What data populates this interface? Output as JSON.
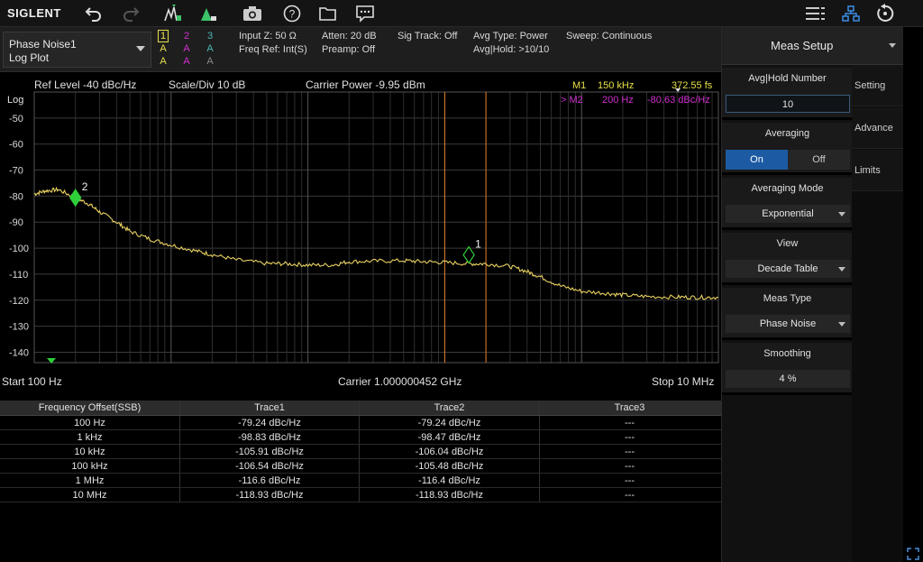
{
  "toolbar": {
    "logo": "SIGLENT"
  },
  "mode": {
    "line1": "Phase Noise1",
    "line2": "Log Plot"
  },
  "traces": [
    {
      "num": "1",
      "row2": "A",
      "row3": "A",
      "color": "#e8e04a"
    },
    {
      "num": "2",
      "row2": "A",
      "row3": "A",
      "color": "#d030d0"
    },
    {
      "num": "3",
      "row2": "A",
      "row3": "A",
      "color": "#4ab8b8"
    }
  ],
  "info": {
    "input_z": "Input Z: 50 Ω",
    "freq_ref": "Freq Ref: Int(S)",
    "atten": "Atten: 20 dB",
    "preamp": "Preamp: Off",
    "sig_track": "Sig Track: Off",
    "avg_type": "Avg Type: Power",
    "avg_hold": "Avg|Hold: >10/10",
    "sweep": "Sweep: Continuous"
  },
  "plot_header": {
    "ref_level": "Ref Level  -40 dBc/Hz",
    "scale": "Scale/Div  10 dB",
    "carrier_power": "Carrier Power  -9.95 dBm",
    "m1_label": "M1",
    "m1_freq": "150 kHz",
    "m1_val": "372.55 fs",
    "m2_label": "> M2",
    "m2_freq": "200 Hz",
    "m2_val": "-80.63 dBc/Hz"
  },
  "y_unit": "Log",
  "y_ticks": [
    "-50",
    "-60",
    "-70",
    "-80",
    "-90",
    "-100",
    "-110",
    "-120",
    "-130",
    "-140"
  ],
  "plot_footer": {
    "start": "Start  100 Hz",
    "carrier": "Carrier  1.000000452 GHz",
    "stop": "Stop  10 MHz"
  },
  "chart_data": {
    "type": "line",
    "x_scale": "log",
    "xlim": [
      100,
      10000000
    ],
    "ylim": [
      -144,
      -40
    ],
    "series": [
      {
        "color": "#e8d060",
        "x": [
          100,
          120,
          150,
          200,
          250,
          300,
          400,
          500,
          700,
          1000,
          1500,
          2000,
          3000,
          5000,
          7000,
          10000,
          15000,
          20000,
          30000,
          50000,
          70000,
          100000,
          150000,
          200000,
          300000,
          400000,
          500000,
          700000,
          1000000,
          1500000,
          2000000,
          3000000,
          5000000,
          7000000,
          10000000
        ],
        "y": [
          -79.2,
          -78,
          -77.5,
          -80.6,
          -83,
          -86,
          -90,
          -93.5,
          -96.5,
          -98.8,
          -101,
          -102.5,
          -104.5,
          -105.9,
          -106,
          -106.5,
          -106.5,
          -105.2,
          -105,
          -104.8,
          -105.2,
          -105.5,
          -106,
          -106,
          -107,
          -109,
          -111,
          -114.5,
          -116.6,
          -117.3,
          -118,
          -118.6,
          -118.8,
          -118.9,
          -118.9
        ]
      }
    ],
    "markers": [
      {
        "label": "1",
        "x": 150000,
        "y": -102.6
      },
      {
        "label": "2",
        "x": 200,
        "y": -80.63
      }
    ],
    "vlines": [
      100000,
      200000
    ]
  },
  "table": {
    "headers": [
      "Frequency Offset(SSB)",
      "Trace1",
      "Trace2",
      "Trace3"
    ],
    "rows": [
      [
        "100 Hz",
        "-79.24 dBc/Hz",
        "-79.24 dBc/Hz",
        "---"
      ],
      [
        "1 kHz",
        "-98.83 dBc/Hz",
        "-98.47 dBc/Hz",
        "---"
      ],
      [
        "10 kHz",
        "-105.91 dBc/Hz",
        "-106.04 dBc/Hz",
        "---"
      ],
      [
        "100 kHz",
        "-106.54 dBc/Hz",
        "-105.48 dBc/Hz",
        "---"
      ],
      [
        "1 MHz",
        "-116.6 dBc/Hz",
        "-116.4 dBc/Hz",
        "---"
      ],
      [
        "10 MHz",
        "-118.93 dBc/Hz",
        "-118.93 dBc/Hz",
        "---"
      ]
    ]
  },
  "panel": {
    "title": "Meas Setup",
    "avg_hold_label": "Avg|Hold Number",
    "avg_hold_value": "10",
    "averaging_label": "Averaging",
    "averaging_on": "On",
    "averaging_off": "Off",
    "avg_mode_label": "Averaging Mode",
    "avg_mode_value": "Exponential",
    "view_label": "View",
    "view_value": "Decade Table",
    "meas_type_label": "Meas Type",
    "meas_type_value": "Phase Noise",
    "smoothing_label": "Smoothing",
    "smoothing_value": "4 %"
  },
  "side_tabs": [
    "Setting",
    "Advance",
    "Limits"
  ]
}
